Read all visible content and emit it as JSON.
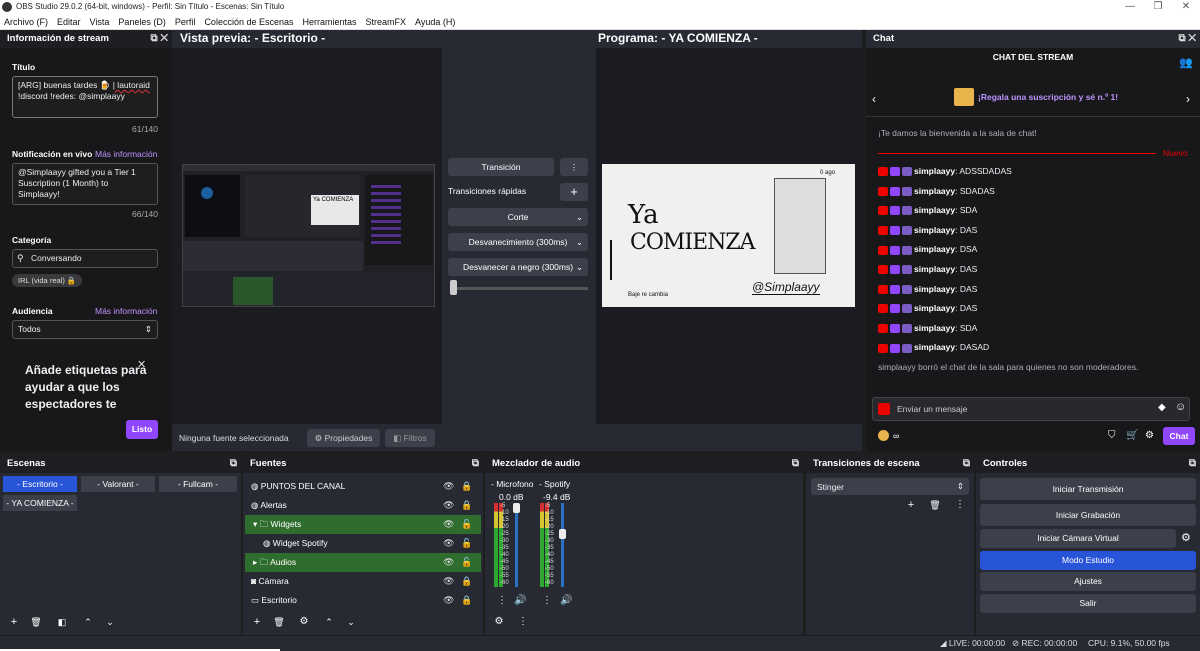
{
  "window": {
    "title": "OBS Studio 29.0.2 (64-bit, windows) - Perfil: Sin Título - Escenas: Sin Título"
  },
  "menu": [
    "Archivo (F)",
    "Editar",
    "Vista",
    "Paneles (D)",
    "Perfil",
    "Colección de Escenas",
    "Herramientas",
    "StreamFX",
    "Ayuda (H)"
  ],
  "stream_info": {
    "header": "Información de stream",
    "title_label": "Título",
    "title_value_1": "[ARG] buenas tardes",
    "title_value_2": "| lautoraid",
    "title_value_3": "!discord !redes: @simplaayy",
    "title_count": "61/140",
    "notif_label": "Notificación en vivo",
    "more_info": "Más información",
    "notif_value": "@Simplaayy gifted you a Tier 1 Suscription (1 Month) to Simplaayy!",
    "notif_count": "66/140",
    "category_label": "Categoría",
    "category_value": "Conversando",
    "tag": "IRL (vida real)",
    "audience_label": "Audiencia",
    "audience_more": "Más información",
    "audience_value": "Todos",
    "promo": "Añade etiquetas para ayudar a que los espectadores te",
    "promo_btn": "Listo"
  },
  "preview": {
    "label": "Vista previa: - Escritorio -",
    "program_label": "Programa: - YA COMIENZA -",
    "no_source": "Ninguna fuente seleccionada",
    "properties": "Propiedades",
    "filters": "Filtros"
  },
  "program_image": {
    "line1": "Ya",
    "line2": "COMIENZA",
    "handle": "@Simplaayy",
    "corner": "0 ago",
    "note": "Baje re cambia"
  },
  "transitions_center": {
    "transition_btn": "Transición",
    "quick": "Transiciones rápidas",
    "cut": "Corte",
    "fade": "Desvanecimiento (300ms)",
    "fade_black": "Desvanecer a negro (300ms)"
  },
  "chat": {
    "header": "Chat",
    "title": "CHAT DEL STREAM",
    "promo": "¡Regala una suscripción y sé n.º 1!",
    "welcome": "¡Te damos la bienvenida a la sala de chat!",
    "new_label": "Nuevo",
    "user": "simplaayy",
    "messages": [
      "ADSSDADAS",
      "SDADAS",
      "SDA",
      "DAS",
      "DSA",
      "DAS",
      "DAS",
      "DAS",
      "SDA",
      "DASAD"
    ],
    "cleared": "simplaayy borró el chat de la sala para quienes no son moderadores.",
    "input_placeholder": "Enviar un mensaje",
    "infinity": "∞",
    "chat_btn": "Chat"
  },
  "scenes": {
    "header": "Escenas",
    "items": [
      "- Escritorio -",
      "- Valorant -",
      "- Fullcam -",
      "- YA COMIENZA -"
    ]
  },
  "sources": {
    "header": "Fuentes",
    "items": [
      "PUNTOS DEL CANAL",
      "Alertas",
      "Widgets",
      "Widget Spotify",
      "Audios",
      "Cámara",
      "Escritorio"
    ]
  },
  "mixer": {
    "header": "Mezclador de audio",
    "ch1_name": "- Microfono",
    "ch1_db": "0.0 dB",
    "ch2_name": "- Spotify",
    "ch2_db": "-9.4 dB",
    "scale": [
      "-5",
      "-10",
      "-15",
      "-20",
      "-25",
      "-30",
      "-35",
      "-40",
      "-45",
      "-50",
      "-55",
      "-60"
    ]
  },
  "scene_transitions": {
    "header": "Transiciones de escena",
    "value": "Stinger"
  },
  "controls": {
    "header": "Controles",
    "start_stream": "Iniciar Transmisión",
    "start_rec": "Iniciar Grabación",
    "virtual_cam": "Iniciar Cámara Virtual",
    "studio": "Modo Estudio",
    "settings": "Ajustes",
    "exit": "Salir"
  },
  "status": {
    "live": "LIVE: 00:00:00",
    "rec": "REC: 00:00:00",
    "cpu": "CPU: 9.1%, 50.00 fps"
  },
  "colors": {
    "accent_purple": "#9147ff",
    "studio_blue": "#2855d8",
    "obs_dark": "#272a33"
  }
}
